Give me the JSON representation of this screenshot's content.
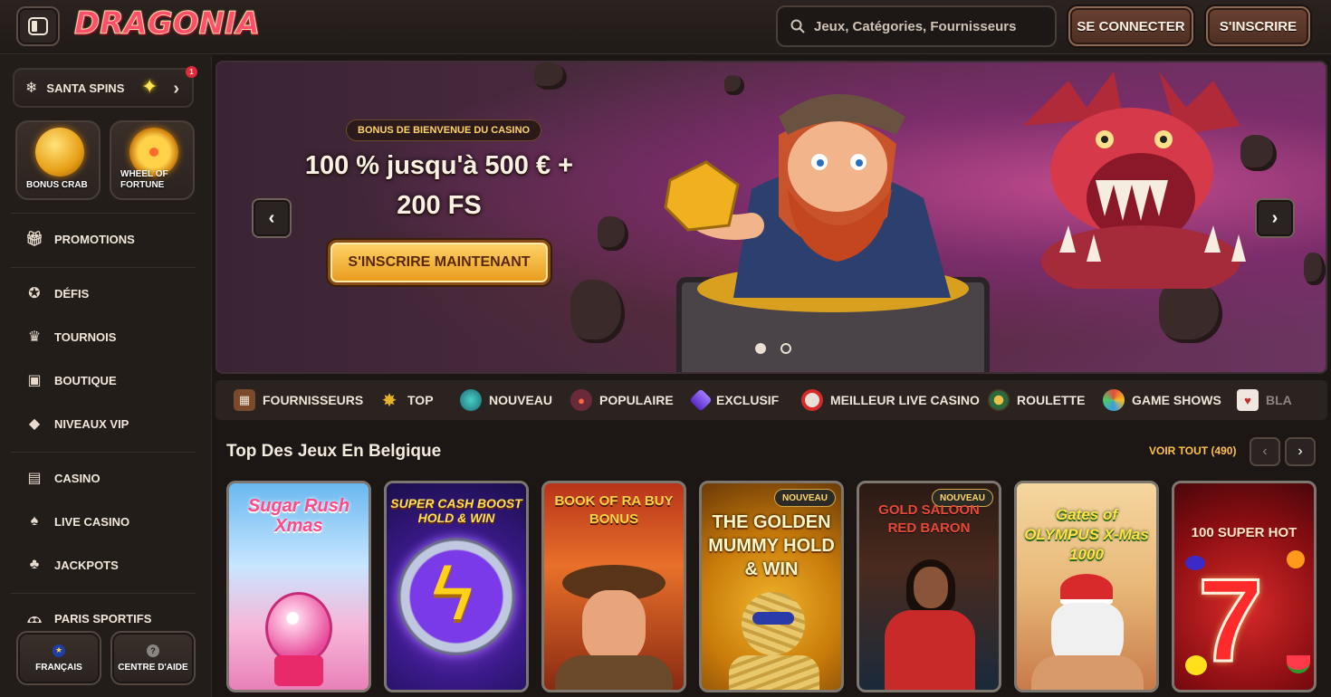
{
  "header": {
    "logo_text": "DRAGONIA",
    "search_placeholder": "Jeux, Catégories, Fournisseurs",
    "login_label": "SE CONNECTER",
    "signup_label": "S'INSCRIRE"
  },
  "sidebar": {
    "santa_label": "SANTA SPINS",
    "santa_badge": "1",
    "tiles": [
      {
        "label": "BONUS CRAB"
      },
      {
        "label": "WHEEL OF FORTUNE"
      }
    ],
    "nav": [
      {
        "label": "PROMOTIONS",
        "icon": "gift-icon"
      },
      {
        "label": "DÉFIS",
        "icon": "badge-icon"
      },
      {
        "label": "TOURNOIS",
        "icon": "trophy-icon"
      },
      {
        "label": "BOUTIQUE",
        "icon": "bag-icon"
      },
      {
        "label": "NIVEAUX VIP",
        "icon": "diamond-icon"
      },
      {
        "label": "CASINO",
        "icon": "slot-machine-icon"
      },
      {
        "label": "LIVE CASINO",
        "icon": "cards-icon"
      },
      {
        "label": "JACKPOTS",
        "icon": "clover-icon"
      },
      {
        "label": "PARIS SPORTIFS",
        "icon": "ball-icon"
      }
    ],
    "language_label": "FRANÇAIS",
    "help_label": "CENTRE D'AIDE"
  },
  "banner": {
    "tag": "BONUS DE BIENVENUE DU CASINO",
    "headline_line1": "100 % jusqu'à 500 € +",
    "headline_line2": "200 FS",
    "cta": "S'INSCRIRE MAINTENANT",
    "slides": 2,
    "active_slide": 1
  },
  "categories": [
    {
      "label": "FOURNISSEURS",
      "icon": "chest-icon"
    },
    {
      "label": "TOP",
      "icon": "star-icon"
    },
    {
      "label": "NOUVEAU",
      "icon": "gem-icon"
    },
    {
      "label": "POPULAIRE",
      "icon": "bomb-icon"
    },
    {
      "label": "EXCLUSIF",
      "icon": "crystal-icon"
    },
    {
      "label": "MEILLEUR LIVE CASINO",
      "icon": "chip-icon"
    },
    {
      "label": "ROULETTE",
      "icon": "roulette-icon"
    },
    {
      "label": "GAME SHOWS",
      "icon": "wheel-icon"
    },
    {
      "label": "BLA",
      "icon": "cards-icon"
    }
  ],
  "section": {
    "title": "Top Des Jeux En Belgique",
    "see_all": "VOIR TOUT (490)"
  },
  "games": [
    {
      "title": "Sugar Rush Xmas",
      "badge": ""
    },
    {
      "title": "SUPER CASH BOOST HOLD & WIN",
      "badge": ""
    },
    {
      "title": "BOOK OF RA BUY BONUS",
      "badge": ""
    },
    {
      "title": "THE GOLDEN MUMMY HOLD & WIN",
      "badge": "NOUVEAU"
    },
    {
      "title": "GOLD SALOON RED BARON",
      "badge": "NOUVEAU"
    },
    {
      "title": "Gates of OLYMPUS X-Mas 1000",
      "badge": ""
    },
    {
      "title": "100 SUPER HOT",
      "badge": ""
    }
  ]
}
